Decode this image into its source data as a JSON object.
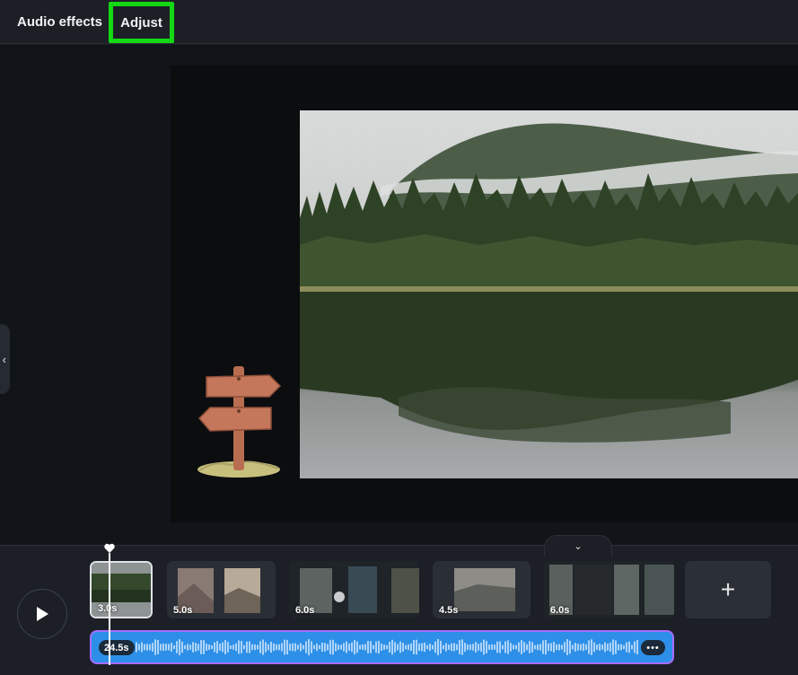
{
  "tabs": {
    "audio_effects": "Audio effects",
    "adjust": "Adjust"
  },
  "timeline": {
    "clips": [
      {
        "duration": "3.0s",
        "selected": true
      },
      {
        "duration": "5.0s"
      },
      {
        "duration": "6.0s"
      },
      {
        "duration": "4.5s"
      },
      {
        "duration": "6.0s"
      }
    ],
    "add_label": "+",
    "audio": {
      "duration": "24.5s",
      "more_label": "•••"
    }
  },
  "colors": {
    "highlight": "#14d814",
    "audio_track": "#2d8fe7",
    "audio_border": "#a66bff"
  }
}
